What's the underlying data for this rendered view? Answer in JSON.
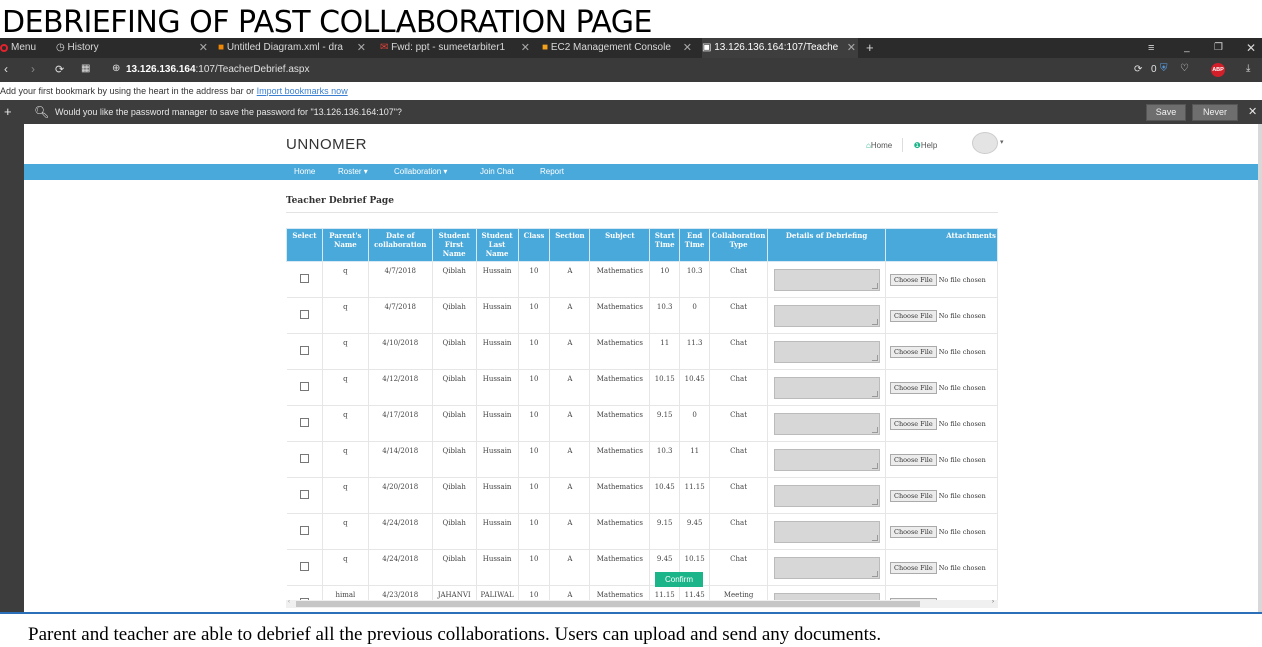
{
  "heading": "DEBRIEFING OF PAST COLLABORATION PAGE",
  "caption": "Parent and teacher are able to debrief all the previous collaborations. Users can upload and send any documents.",
  "browser": {
    "menu_label": "Menu",
    "tabs": [
      {
        "label": "History"
      },
      {
        "label": "Untitled Diagram.xml - dra"
      },
      {
        "label": "Fwd: ppt - sumeetarbiter1"
      },
      {
        "label": "EC2 Management Console"
      },
      {
        "label": "13.126.136.164:107/Teache"
      }
    ],
    "new_tab": "+",
    "url_host": "13.126.136.164",
    "url_path": ":107/TeacherDebrief.aspx",
    "counter": "0",
    "abp_label": "ABP",
    "bookmark_text": "Add your first bookmark by using the heart in the address bar or",
    "bookmark_link": "Import bookmarks now",
    "pw_prompt": "Would you like the password manager to save the password for \"13.126.136.164:107\"?",
    "save_label": "Save",
    "never_label": "Never"
  },
  "site": {
    "brand": "UNNOMER",
    "home_label": "Home",
    "help_label": "Help",
    "nav": [
      "Home",
      "Roster ▾",
      "Collaboration ▾",
      "Join Chat",
      "Report"
    ],
    "page_title": "Teacher Debrief Page",
    "confirm_label": "Confirm"
  },
  "table": {
    "headers": [
      "Select",
      "Parent's Name",
      "Date of collaboration",
      "Student First Name",
      "Student Last Name",
      "Class",
      "Section",
      "Subject",
      "Start Time",
      "End Time",
      "Collaboration Type",
      "Details of Debriefing",
      "Attachments"
    ],
    "choose_file": "Choose File",
    "no_file": "No file chosen",
    "rows": [
      {
        "parent": "q",
        "date": "4/7/2018",
        "first": "Qiblah",
        "last": "Hussain",
        "class": "10",
        "section": "A",
        "subject": "Mathematics",
        "start": "10",
        "end": "10.3",
        "type": "Chat"
      },
      {
        "parent": "q",
        "date": "4/7/2018",
        "first": "Qiblah",
        "last": "Hussain",
        "class": "10",
        "section": "A",
        "subject": "Mathematics",
        "start": "10.3",
        "end": "0",
        "type": "Chat"
      },
      {
        "parent": "q",
        "date": "4/10/2018",
        "first": "Qiblah",
        "last": "Hussain",
        "class": "10",
        "section": "A",
        "subject": "Mathematics",
        "start": "11",
        "end": "11.3",
        "type": "Chat"
      },
      {
        "parent": "q",
        "date": "4/12/2018",
        "first": "Qiblah",
        "last": "Hussain",
        "class": "10",
        "section": "A",
        "subject": "Mathematics",
        "start": "10.15",
        "end": "10.45",
        "type": "Chat"
      },
      {
        "parent": "q",
        "date": "4/17/2018",
        "first": "Qiblah",
        "last": "Hussain",
        "class": "10",
        "section": "A",
        "subject": "Mathematics",
        "start": "9.15",
        "end": "0",
        "type": "Chat"
      },
      {
        "parent": "q",
        "date": "4/14/2018",
        "first": "Qiblah",
        "last": "Hussain",
        "class": "10",
        "section": "A",
        "subject": "Mathematics",
        "start": "10.3",
        "end": "11",
        "type": "Chat"
      },
      {
        "parent": "q",
        "date": "4/20/2018",
        "first": "Qiblah",
        "last": "Hussain",
        "class": "10",
        "section": "A",
        "subject": "Mathematics",
        "start": "10.45",
        "end": "11.15",
        "type": "Chat"
      },
      {
        "parent": "q",
        "date": "4/24/2018",
        "first": "Qiblah",
        "last": "Hussain",
        "class": "10",
        "section": "A",
        "subject": "Mathematics",
        "start": "9.15",
        "end": "9.45",
        "type": "Chat"
      },
      {
        "parent": "q",
        "date": "4/24/2018",
        "first": "Qiblah",
        "last": "Hussain",
        "class": "10",
        "section": "A",
        "subject": "Mathematics",
        "start": "9.45",
        "end": "10.15",
        "type": "Chat"
      },
      {
        "parent": "himal",
        "date": "4/23/2018",
        "first": "JAHANVI",
        "last": "PALIWAL",
        "class": "10",
        "section": "A",
        "subject": "Mathematics",
        "start": "11.15",
        "end": "11.45",
        "type": "Meeting"
      }
    ]
  }
}
